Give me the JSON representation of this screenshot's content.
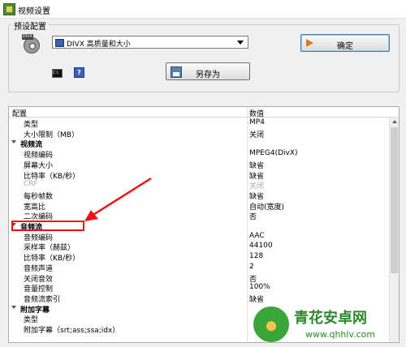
{
  "window": {
    "title": "视频设置"
  },
  "preset": {
    "group_label": "预设配置",
    "selected": "DIVX 高质量和大小",
    "ok_label": "确定",
    "saveas_label": "另存为",
    "help_glyph": "?",
    "disc_tag": "DIVX",
    "cmd_glyph": "C:\\"
  },
  "grid": {
    "col_setting": "配置",
    "col_value": "数值",
    "rows": [
      {
        "label": "类型",
        "value": "MP4"
      },
      {
        "label": "大小限制（MB）",
        "value": "关闭"
      },
      {
        "label": "视频流",
        "value": "",
        "section": true
      },
      {
        "label": "视频编码",
        "value": "MPEG4(DivX)"
      },
      {
        "label": "屏幕大小",
        "value": "缺省"
      },
      {
        "label": "比特率（KB/秒）",
        "value": "缺省"
      },
      {
        "label": "CRF",
        "value": "关闭",
        "disabled": true
      },
      {
        "label": "每秒帧数",
        "value": "缺省"
      },
      {
        "label": "宽高比",
        "value": "自动(宽度)"
      },
      {
        "label": "二次编码",
        "value": "否"
      },
      {
        "label": "音频流",
        "value": "",
        "section": true
      },
      {
        "label": "音频编码",
        "value": "AAC"
      },
      {
        "label": "采样率（赫兹）",
        "value": "44100"
      },
      {
        "label": "比特率（KB/秒）",
        "value": "128"
      },
      {
        "label": "音频声道",
        "value": "2"
      },
      {
        "label": "关闭音效",
        "value": "否"
      },
      {
        "label": "音量控制",
        "value": "100%"
      },
      {
        "label": "音频流索引",
        "value": "缺省"
      },
      {
        "label": "附加字幕",
        "value": "",
        "section": true
      },
      {
        "label": "类型",
        "value": ""
      },
      {
        "label": "附加字幕（srt;ass;ssa;idx）",
        "value": ""
      }
    ]
  },
  "watermark": {
    "name": "青花安卓网",
    "url": "www.qhhlv.com"
  },
  "colors": {
    "highlight": "#ee1111",
    "arrow": "#ee1111",
    "ok_accent": "#e07a1c"
  }
}
